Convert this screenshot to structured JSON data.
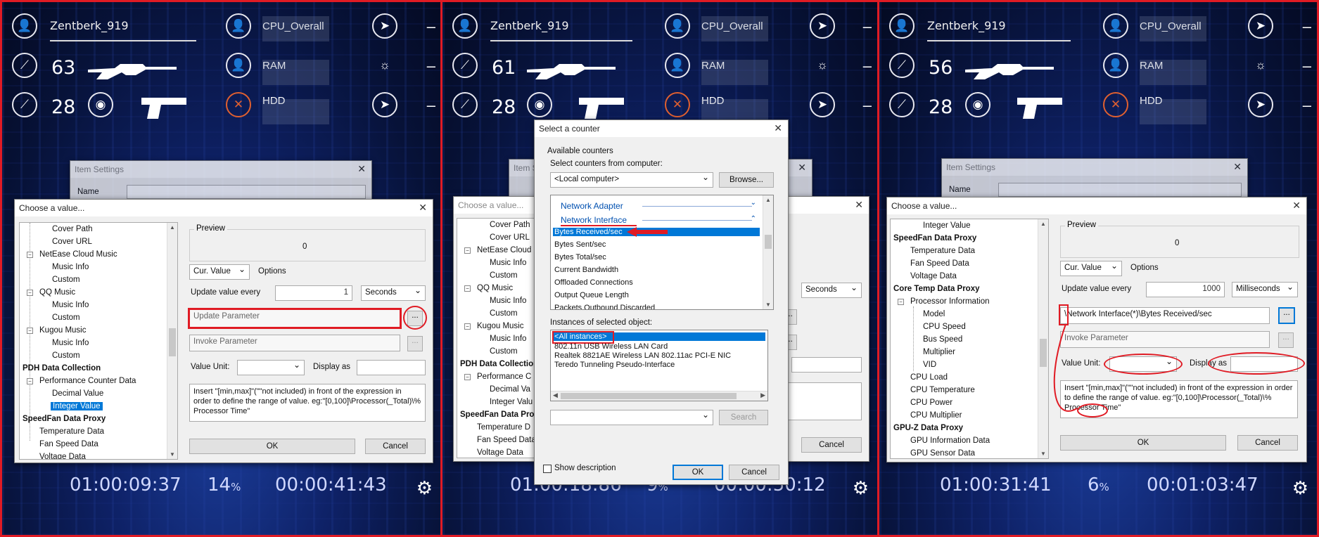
{
  "hud": {
    "user": "Zentberk_919",
    "cpu_label": "CPU_Overall",
    "ram_label": "RAM",
    "hdd_label": "HDD",
    "dash": "–",
    "panels": [
      {
        "ammo1": "63",
        "ammo2": "28"
      },
      {
        "ammo1": "61",
        "ammo2": "28"
      },
      {
        "ammo1": "56",
        "ammo2": "28"
      }
    ]
  },
  "bottom": [
    {
      "time1": "01:00:09:37",
      "pct": "14",
      "pct_unit": "%",
      "time2": "00:00:41:43"
    },
    {
      "time1": "01:00:18:86",
      "pct": "9",
      "pct_unit": "%",
      "time2": "00:00:50:12"
    },
    {
      "time1": "01:00:31:41",
      "pct": "6",
      "pct_unit": "%",
      "time2": "00:01:03:47"
    }
  ],
  "item_settings": {
    "title": "Item Settings",
    "name_label": "Name"
  },
  "choose": {
    "title": "Choose a value...",
    "preview_label": "Preview",
    "preview_value": "0",
    "cur_value": "Cur. Value",
    "options_label": "Options",
    "update_every_label": "Update value every",
    "update_interval_1": "1",
    "update_unit_1": "Seconds",
    "update_interval_3": "1000",
    "update_unit_3": "Milliseconds",
    "update_param_placeholder": "Update Parameter",
    "update_param_value_3": "\\Network Interface(*)\\Bytes Received/sec",
    "invoke_param_placeholder": "Invoke Parameter",
    "browse_btn": "...",
    "value_unit_label": "Value Unit:",
    "display_as_label": "Display as",
    "help_text": "Insert \"[min,max]\"(\"\"not included) in front of the expression in order to define the range of value. eg:\"[0,100]\\Processor(_Total)\\% Processor Time\"",
    "ok": "OK",
    "cancel": "Cancel",
    "tree1": [
      "Cover Path",
      "Cover URL",
      "NetEase Cloud Music",
      "Music Info",
      "Custom",
      "QQ Music",
      "Music Info",
      "Custom",
      "Kugou Music",
      "Music Info",
      "Custom",
      "PDH Data Collection",
      "Performance Counter Data",
      "Decimal Value",
      "Integer Value",
      "SpeedFan Data Proxy",
      "Temperature Data",
      "Fan Speed Data",
      "Voltage Data"
    ],
    "tree2": [
      "Cover Path",
      "Cover URL",
      "NetEase Cloud",
      "Music Info",
      "Custom",
      "QQ Music",
      "Music Info",
      "Custom",
      "Kugou Music",
      "Music Info",
      "Custom",
      "PDH Data Collection",
      "Performance C",
      "Decimal Va",
      "Integer Valu",
      "SpeedFan Data Pro",
      "Temperature D",
      "Fan Speed Data",
      "Voltage Data"
    ],
    "tree3": [
      "Integer Value",
      "SpeedFan Data Proxy",
      "Temperature Data",
      "Fan Speed Data",
      "Voltage Data",
      "Core Temp Data Proxy",
      "Processor Information",
      "Model",
      "CPU Speed",
      "Bus Speed",
      "Multiplier",
      "VID",
      "CPU Load",
      "CPU Temperature",
      "CPU Power",
      "CPU Multiplier",
      "GPU-Z Data Proxy",
      "GPU Information Data",
      "GPU Sensor Data"
    ]
  },
  "counter": {
    "title": "Select a counter",
    "available_label": "Available counters",
    "from_computer_label": "Select counters from computer:",
    "computer_value": "<Local computer>",
    "browse_btn": "Browse...",
    "categories": [
      "Network Adapter",
      "Network Interface"
    ],
    "counters": [
      "Bytes Received/sec",
      "Bytes Sent/sec",
      "Bytes Total/sec",
      "Current Bandwidth",
      "Offloaded Connections",
      "Output Queue Length",
      "Packets Outbound Discarded"
    ],
    "instances_label": "Instances of selected object:",
    "instances": [
      "<All instances>",
      "802.11n USB Wireless LAN Card",
      "Realtek 8821AE Wireless LAN 802.11ac PCI-E NIC",
      "Teredo Tunneling Pseudo-Interface"
    ],
    "search_btn": "Search",
    "show_description": "Show description",
    "ok": "OK",
    "cancel": "Cancel"
  }
}
